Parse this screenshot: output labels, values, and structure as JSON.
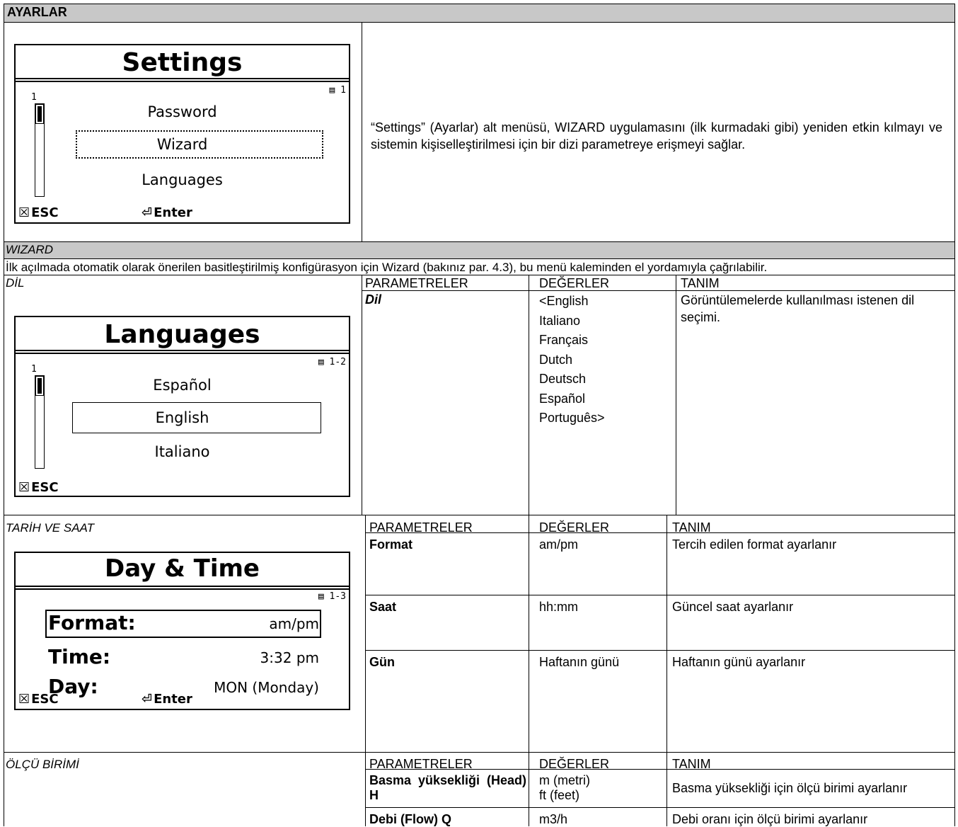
{
  "header": {
    "title": "AYARLAR"
  },
  "settings_screen": {
    "title": "Settings",
    "page_indicator": "1",
    "scroll_index": "1",
    "items": [
      "Password",
      "Wizard",
      "Languages"
    ],
    "footer": {
      "esc": "ESC",
      "enter": "Enter"
    }
  },
  "settings_description": "“Settings” (Ayarlar) alt menüsü, WIZARD uygulamasını (ilk kurmadaki gibi) yeniden etkin kılmayı ve sistemin kişiselleştirilmesi için bir dizi parametreye erişmeyi sağlar.",
  "wizard": {
    "heading": "WIZARD",
    "text": "İlk açılmada otomatik olarak önerilen basitleştirilmiş konfigürasyon için Wizard (bakınız par. 4.3), bu menü kaleminden el yordamıyla çağrılabilir."
  },
  "columns": {
    "param": "PARAMETRELER",
    "values": "DEĞERLER",
    "desc": "TANIM"
  },
  "language_section": {
    "heading": "DİL",
    "screen": {
      "title": "Languages",
      "page_indicator": "1-2",
      "scroll_index": "1",
      "items": [
        "Español",
        "English",
        "Italiano"
      ],
      "footer": {
        "esc": "ESC"
      }
    },
    "param": "Dil",
    "values": "<English\nItaliano\nFrançais\nDutch\nDeutsch\nEspañol\nPortuguês>",
    "desc": "Görüntülemelerde kullanılması istenen dil seçimi."
  },
  "datetime_section": {
    "heading": "TARİH VE SAAT",
    "screen": {
      "title": "Day & Time",
      "page_indicator": "1-3",
      "rows": [
        {
          "label": "Format:",
          "value": "am/pm"
        },
        {
          "label": "Time:",
          "value": "3:32 pm"
        },
        {
          "label": "Day:",
          "value": "MON (Monday)"
        }
      ],
      "footer": {
        "esc": "ESC",
        "enter": "Enter"
      }
    },
    "rows": [
      {
        "param": "Format",
        "values": "am/pm",
        "desc": "Tercih edilen format ayarlanır"
      },
      {
        "param": "Saat",
        "values": "hh:mm",
        "desc": "Güncel saat ayarlanır"
      },
      {
        "param": "Gün",
        "values": "Haftanın günü",
        "desc": "Haftanın günü ayarlanır"
      }
    ]
  },
  "units_section": {
    "heading": "ÖLÇÜ BİRİMİ",
    "rows": [
      {
        "param": "Basma yüksekliği (Head) H",
        "values": "m (metri)\nft (feet)",
        "desc": "Basma yüksekliği için ölçü birimi ayarlanır"
      },
      {
        "param": "Debi (Flow) Q",
        "values": "m3/h",
        "desc": "Debi oranı için ölçü birimi ayarlanır"
      }
    ]
  }
}
